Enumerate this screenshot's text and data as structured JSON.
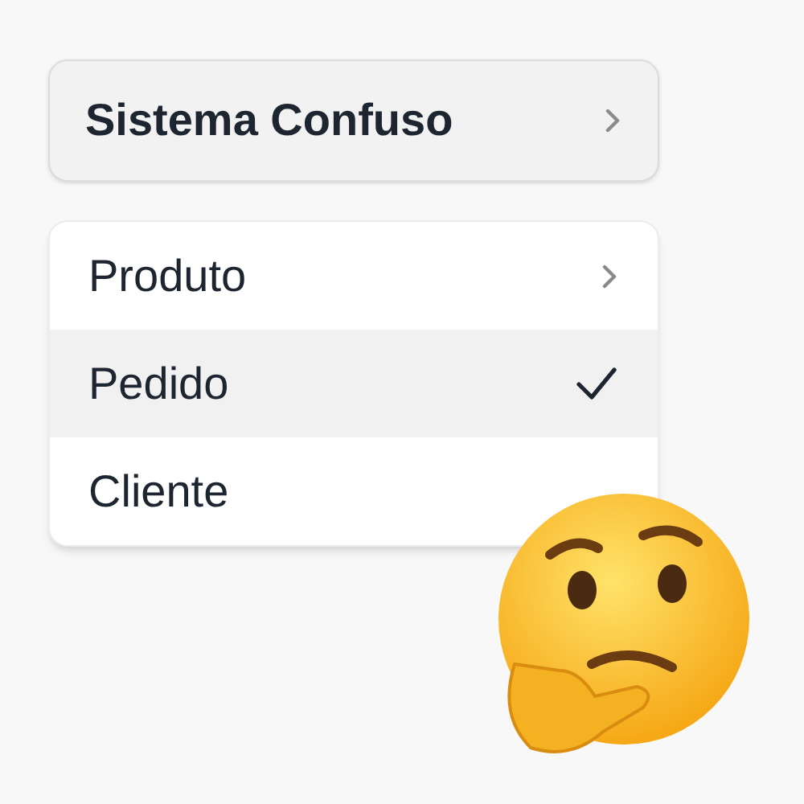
{
  "button": {
    "label": "Sistema Confuso"
  },
  "menu": {
    "items": [
      {
        "label": "Produto",
        "kind": "submenu",
        "selected": false
      },
      {
        "label": "Pedido",
        "kind": "check",
        "selected": true
      },
      {
        "label": "Cliente",
        "kind": "plain",
        "selected": false
      }
    ]
  }
}
